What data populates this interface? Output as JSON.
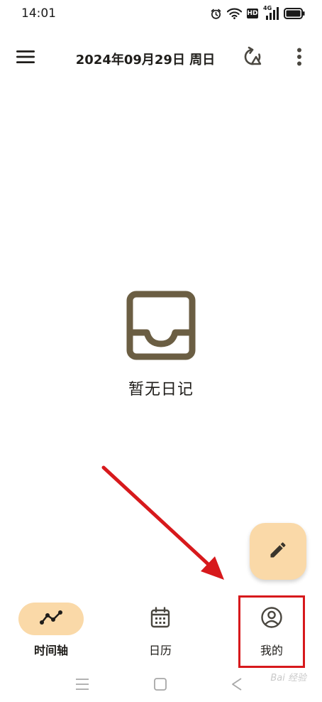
{
  "status_bar": {
    "time": "14:01",
    "icons": [
      "alarm-icon",
      "wifi-icon",
      "hd-badge",
      "signal-4g-icon",
      "battery-icon"
    ],
    "hd_label": "HD",
    "network_label": "4G"
  },
  "header": {
    "title": "2024年09月29日 周日",
    "menu_icon": "hamburger-menu-icon",
    "sync_icon": "sync-icon",
    "more_icon": "more-vertical-icon"
  },
  "empty_state": {
    "icon": "inbox-tray-icon",
    "text": "暂无日记"
  },
  "fab": {
    "icon": "pencil-icon"
  },
  "bottom_nav": {
    "items": [
      {
        "label": "时间轴",
        "icon": "timeline-icon",
        "active": true
      },
      {
        "label": "日历",
        "icon": "calendar-icon",
        "active": false
      },
      {
        "label": "我的",
        "icon": "profile-icon",
        "active": false
      }
    ]
  },
  "system_nav": {
    "icons": [
      "recents-icon",
      "home-icon",
      "back-icon"
    ]
  },
  "watermark": {
    "text": "Bai 经验"
  },
  "colors": {
    "accent": "#fad9a8",
    "icon_brown": "#6b5e43",
    "annotation_red": "#d7191c",
    "text_dark": "#1f1d1a"
  }
}
